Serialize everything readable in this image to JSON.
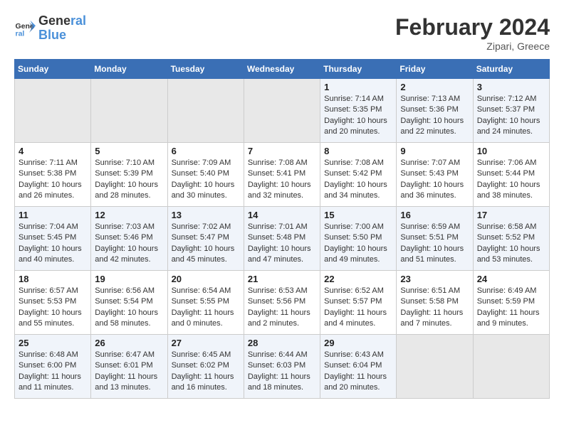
{
  "logo": {
    "line1": "General",
    "line2": "Blue"
  },
  "title": "February 2024",
  "subtitle": "Zipari, Greece",
  "days_of_week": [
    "Sunday",
    "Monday",
    "Tuesday",
    "Wednesday",
    "Thursday",
    "Friday",
    "Saturday"
  ],
  "weeks": [
    [
      {
        "day": "",
        "info": ""
      },
      {
        "day": "",
        "info": ""
      },
      {
        "day": "",
        "info": ""
      },
      {
        "day": "",
        "info": ""
      },
      {
        "day": "1",
        "info": "Sunrise: 7:14 AM\nSunset: 5:35 PM\nDaylight: 10 hours\nand 20 minutes."
      },
      {
        "day": "2",
        "info": "Sunrise: 7:13 AM\nSunset: 5:36 PM\nDaylight: 10 hours\nand 22 minutes."
      },
      {
        "day": "3",
        "info": "Sunrise: 7:12 AM\nSunset: 5:37 PM\nDaylight: 10 hours\nand 24 minutes."
      }
    ],
    [
      {
        "day": "4",
        "info": "Sunrise: 7:11 AM\nSunset: 5:38 PM\nDaylight: 10 hours\nand 26 minutes."
      },
      {
        "day": "5",
        "info": "Sunrise: 7:10 AM\nSunset: 5:39 PM\nDaylight: 10 hours\nand 28 minutes."
      },
      {
        "day": "6",
        "info": "Sunrise: 7:09 AM\nSunset: 5:40 PM\nDaylight: 10 hours\nand 30 minutes."
      },
      {
        "day": "7",
        "info": "Sunrise: 7:08 AM\nSunset: 5:41 PM\nDaylight: 10 hours\nand 32 minutes."
      },
      {
        "day": "8",
        "info": "Sunrise: 7:08 AM\nSunset: 5:42 PM\nDaylight: 10 hours\nand 34 minutes."
      },
      {
        "day": "9",
        "info": "Sunrise: 7:07 AM\nSunset: 5:43 PM\nDaylight: 10 hours\nand 36 minutes."
      },
      {
        "day": "10",
        "info": "Sunrise: 7:06 AM\nSunset: 5:44 PM\nDaylight: 10 hours\nand 38 minutes."
      }
    ],
    [
      {
        "day": "11",
        "info": "Sunrise: 7:04 AM\nSunset: 5:45 PM\nDaylight: 10 hours\nand 40 minutes."
      },
      {
        "day": "12",
        "info": "Sunrise: 7:03 AM\nSunset: 5:46 PM\nDaylight: 10 hours\nand 42 minutes."
      },
      {
        "day": "13",
        "info": "Sunrise: 7:02 AM\nSunset: 5:47 PM\nDaylight: 10 hours\nand 45 minutes."
      },
      {
        "day": "14",
        "info": "Sunrise: 7:01 AM\nSunset: 5:48 PM\nDaylight: 10 hours\nand 47 minutes."
      },
      {
        "day": "15",
        "info": "Sunrise: 7:00 AM\nSunset: 5:50 PM\nDaylight: 10 hours\nand 49 minutes."
      },
      {
        "day": "16",
        "info": "Sunrise: 6:59 AM\nSunset: 5:51 PM\nDaylight: 10 hours\nand 51 minutes."
      },
      {
        "day": "17",
        "info": "Sunrise: 6:58 AM\nSunset: 5:52 PM\nDaylight: 10 hours\nand 53 minutes."
      }
    ],
    [
      {
        "day": "18",
        "info": "Sunrise: 6:57 AM\nSunset: 5:53 PM\nDaylight: 10 hours\nand 55 minutes."
      },
      {
        "day": "19",
        "info": "Sunrise: 6:56 AM\nSunset: 5:54 PM\nDaylight: 10 hours\nand 58 minutes."
      },
      {
        "day": "20",
        "info": "Sunrise: 6:54 AM\nSunset: 5:55 PM\nDaylight: 11 hours\nand 0 minutes."
      },
      {
        "day": "21",
        "info": "Sunrise: 6:53 AM\nSunset: 5:56 PM\nDaylight: 11 hours\nand 2 minutes."
      },
      {
        "day": "22",
        "info": "Sunrise: 6:52 AM\nSunset: 5:57 PM\nDaylight: 11 hours\nand 4 minutes."
      },
      {
        "day": "23",
        "info": "Sunrise: 6:51 AM\nSunset: 5:58 PM\nDaylight: 11 hours\nand 7 minutes."
      },
      {
        "day": "24",
        "info": "Sunrise: 6:49 AM\nSunset: 5:59 PM\nDaylight: 11 hours\nand 9 minutes."
      }
    ],
    [
      {
        "day": "25",
        "info": "Sunrise: 6:48 AM\nSunset: 6:00 PM\nDaylight: 11 hours\nand 11 minutes."
      },
      {
        "day": "26",
        "info": "Sunrise: 6:47 AM\nSunset: 6:01 PM\nDaylight: 11 hours\nand 13 minutes."
      },
      {
        "day": "27",
        "info": "Sunrise: 6:45 AM\nSunset: 6:02 PM\nDaylight: 11 hours\nand 16 minutes."
      },
      {
        "day": "28",
        "info": "Sunrise: 6:44 AM\nSunset: 6:03 PM\nDaylight: 11 hours\nand 18 minutes."
      },
      {
        "day": "29",
        "info": "Sunrise: 6:43 AM\nSunset: 6:04 PM\nDaylight: 11 hours\nand 20 minutes."
      },
      {
        "day": "",
        "info": ""
      },
      {
        "day": "",
        "info": ""
      }
    ]
  ]
}
